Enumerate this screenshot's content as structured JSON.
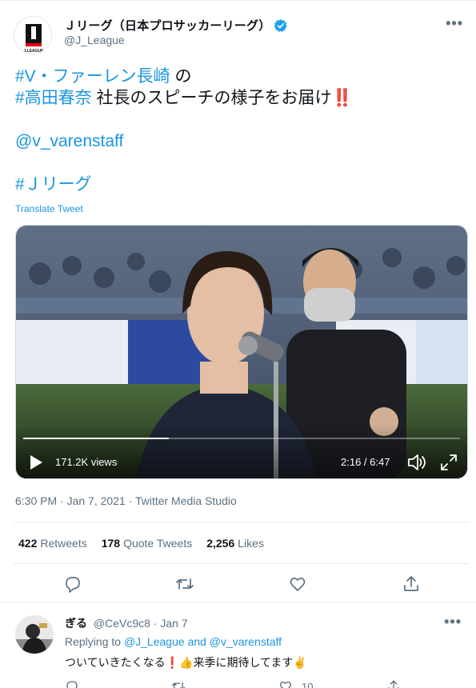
{
  "tweet": {
    "account_name": "Ｊリーグ（日本プロサッカーリーグ）",
    "handle": "@J_League",
    "more_label": "•••",
    "logo_text": "J.LEAGUE",
    "lines": [
      {
        "parts": [
          {
            "text": "#V・ファーレン長崎",
            "link": true
          },
          {
            "text": " の",
            "link": false
          }
        ]
      },
      {
        "parts": [
          {
            "text": "#高田春奈",
            "link": true
          },
          {
            "text": " 社長のスピーチの様子をお届け‼️",
            "link": false
          }
        ]
      },
      {
        "parts": []
      },
      {
        "parts": [
          {
            "text": "@v_varenstaff",
            "link": true
          }
        ]
      },
      {
        "parts": []
      },
      {
        "parts": [
          {
            "text": "#Ｊリーグ",
            "link": true
          }
        ]
      }
    ],
    "translate_label": "Translate Tweet",
    "video": {
      "views": "171.2K views",
      "time": "2:16 / 6:47",
      "progress": 0.334
    },
    "timestamp": "6:30 PM · Jan 7, 2021 · Twitter Media Studio",
    "stats": [
      {
        "count": "422",
        "label": "Retweets"
      },
      {
        "count": "178",
        "label": "Quote Tweets"
      },
      {
        "count": "2,256",
        "label": "Likes"
      }
    ],
    "actions": [
      "reply-icon",
      "retweet-icon",
      "like-icon",
      "share-icon"
    ]
  },
  "reply": {
    "name": "ぎる",
    "handle": "@CeVc9c8",
    "dot": "·",
    "date": "Jan 7",
    "replying_prefix": "Replying to",
    "replying_user1": "@J_League",
    "replying_and": "and",
    "replying_user2": "@v_varenstaff",
    "text": "ついていきたくなる❗👍来季に期待してます✌️",
    "like_count": "10",
    "more_label": "•••"
  },
  "colors": {
    "link": "#1b95e0",
    "secondary_text": "#5b7083",
    "verified": "#1da1f2",
    "divider": "#e6ecf0"
  }
}
